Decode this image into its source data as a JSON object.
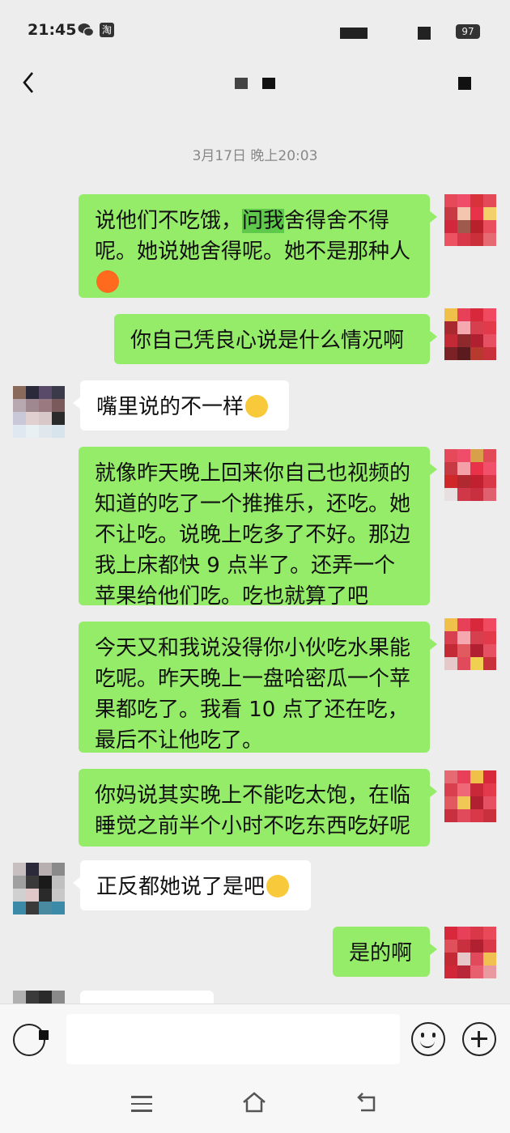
{
  "status_bar": {
    "time": "21:45",
    "icons": [
      "wechat-icon",
      "taobao-icon",
      "signal-icon",
      "wifi-icon",
      "battery-icon"
    ],
    "taobao_glyph": "淘",
    "battery": "97"
  },
  "header": {
    "back_icon": "chevron-left-icon",
    "more_icon": "more-icon"
  },
  "chat": {
    "timestamp": "3月17日 晚上20:03",
    "messages": [
      {
        "side": "out",
        "text_pre": "说他们不吃饿，",
        "text_highlight": "问我",
        "text_post": "舍得舍不得呢。她说她舍得呢。她不是那种人",
        "emoji": "sweat-smile-emoji"
      },
      {
        "side": "out",
        "text": "你自己凭良心说是什么情况啊"
      },
      {
        "side": "in",
        "text": "嘴里说的不一样",
        "emoji": "laugh-cry-emoji"
      },
      {
        "side": "out",
        "text": "就像昨天晚上回来你自己也视频的知道的吃了一个推推乐，还吃。她不让吃。说晚上吃多了不好。那边我上床都快 9 点半了。还弄一个苹果给他们吃。吃也就算了吧"
      },
      {
        "side": "out",
        "text": "今天又和我说没得你小伙吃水果能吃呢。昨天晚上一盘哈密瓜一个苹果都吃了。我看 10 点了还在吃，最后不让他吃了。"
      },
      {
        "side": "out",
        "text": "你妈说其实晚上不能吃太饱，在临睡觉之前半个小时不吃东西吃好呢"
      },
      {
        "side": "in",
        "text": "正反都她说了是吧",
        "emoji": "laugh-cry-emoji"
      },
      {
        "side": "out",
        "text": "是的啊"
      }
    ]
  },
  "input_bar": {
    "voice_icon": "voice-icon",
    "emoji_icon": "emoji-icon",
    "plus_icon": "plus-icon",
    "input_value": ""
  },
  "nav_bar": {
    "icons": [
      "menu-icon",
      "home-icon",
      "back-icon"
    ]
  },
  "colors": {
    "background": "#ededed",
    "outgoing_bubble": "#95ec69",
    "incoming_bubble": "#ffffff",
    "highlight": "#5ec94a"
  }
}
